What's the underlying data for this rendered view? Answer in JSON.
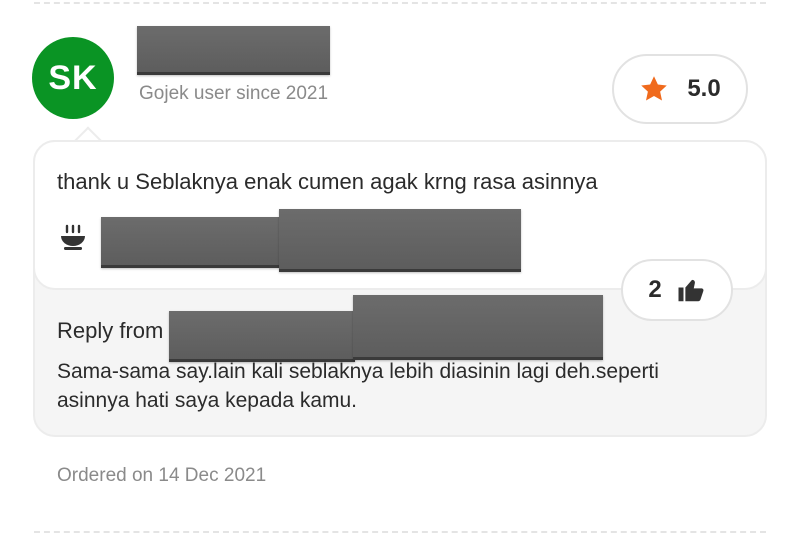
{
  "reviewer": {
    "initials": "SK",
    "avatar_color": "#0a9424",
    "user_since": "Gojek user since 2021"
  },
  "rating": {
    "value": "5.0",
    "icon": "star-icon",
    "star_color": "#f06a1c"
  },
  "review": {
    "text": "thank u Seblaknya enak cumen agak krng rasa asinnya",
    "dish_icon": "food-bowl-icon"
  },
  "likes": {
    "count": "2",
    "icon": "thumbs-up-icon"
  },
  "reply": {
    "label": "Reply from",
    "text": "Sama-sama say.lain kali seblaknya lebih diasinin lagi deh.seperti asinnya hati saya kepada kamu."
  },
  "order": {
    "date_text": "Ordered on 14 Dec 2021"
  }
}
